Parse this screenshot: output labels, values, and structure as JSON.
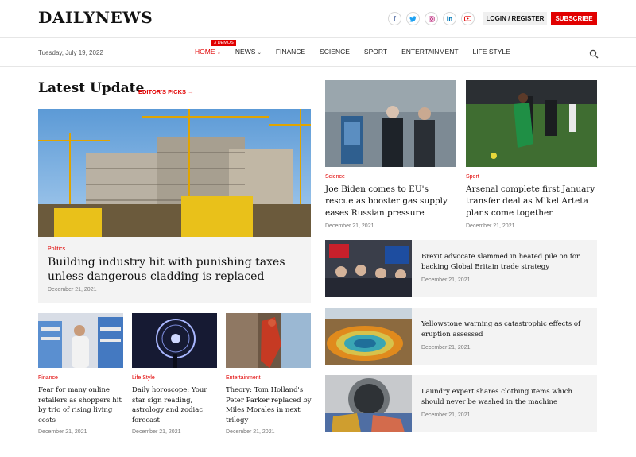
{
  "header": {
    "logo": "DAILYNEWS",
    "socials": [
      "facebook-icon",
      "twitter-icon",
      "instagram-icon",
      "linkedin-icon",
      "youtube-icon"
    ],
    "login_label": "LOGIN / REGISTER",
    "subscribe_label": "SUBSCRIBE"
  },
  "nav": {
    "date": "Tuesday, July 19, 2022",
    "demos_badge": "3 DEMOS",
    "items": [
      {
        "label": "HOME"
      },
      {
        "label": "NEWS"
      },
      {
        "label": "FINANCE"
      },
      {
        "label": "SCIENCE"
      },
      {
        "label": "SPORT"
      },
      {
        "label": "ENTERTAINMENT"
      },
      {
        "label": "LIFE STYLE"
      }
    ]
  },
  "section": {
    "title": "Latest Update",
    "editors_picks": "EDITOR'S PICKS"
  },
  "feature": {
    "category": "Politics",
    "headline": "Building industry hit with punishing taxes unless dangerous cladding is replaced",
    "date": "December 21, 2021"
  },
  "small_cards": [
    {
      "category": "Finance",
      "headline": "Fear for many online retailers as shoppers hit by trio of rising living costs",
      "date": "December 21, 2021"
    },
    {
      "category": "Life Style",
      "headline": "Daily horoscope: Your star sign reading, astrology and zodiac forecast",
      "date": "December 21, 2021"
    },
    {
      "category": "Entertainment",
      "headline": "Theory: Tom Holland's Peter Parker replaced by Miles Morales in next trilogy",
      "date": "December 21, 2021"
    }
  ],
  "top_cards": [
    {
      "category": "Science",
      "headline": "Joe Biden comes to EU's rescue as booster gas supply eases Russian pressure",
      "date": "December 21, 2021"
    },
    {
      "category": "Sport",
      "headline": "Arsenal complete first January transfer deal as Mikel Arteta plans come together",
      "date": "December 21, 2021"
    }
  ],
  "list_items": [
    {
      "headline": "Brexit advocate slammed in heated pile on for backing Global Britain trade strategy",
      "date": "December 21, 2021"
    },
    {
      "headline": "Yellowstone warning as catastrophic effects of eruption assessed",
      "date": "December 21, 2021"
    },
    {
      "headline": "Laundry expert shares clothing items which should never be washed in the machine",
      "date": "December 21, 2021"
    }
  ],
  "colors": {
    "accent": "#e10000",
    "card_bg": "#f3f3f3"
  }
}
